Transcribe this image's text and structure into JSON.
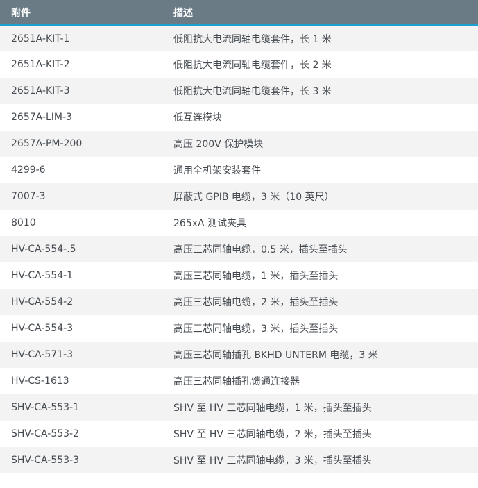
{
  "table": {
    "headers": [
      "附件",
      "描述"
    ],
    "rows": [
      [
        "2651A-KIT-1",
        "低阻抗大电流同轴电缆套件，长 1 米"
      ],
      [
        "2651A-KIT-2",
        "低阻抗大电流同轴电缆套件，长 2 米"
      ],
      [
        "2651A-KIT-3",
        "低阻抗大电流同轴电缆套件，长 3 米"
      ],
      [
        "2657A-LIM-3",
        "低互连模块"
      ],
      [
        "2657A-PM-200",
        "高压 200V 保护模块"
      ],
      [
        "4299-6",
        "通用全机架安装套件"
      ],
      [
        "7007-3",
        "屏蔽式 GPIB 电缆，3 米（10 英尺）"
      ],
      [
        "8010",
        "265xA 测试夹具"
      ],
      [
        "HV-CA-554-.5",
        "高压三芯同轴电缆，0.5 米，插头至插头"
      ],
      [
        "HV-CA-554-1",
        "高压三芯同轴电缆，1 米，插头至插头"
      ],
      [
        "HV-CA-554-2",
        "高压三芯同轴电缆，2 米，插头至插头"
      ],
      [
        "HV-CA-554-3",
        "高压三芯同轴电缆，3 米，插头至插头"
      ],
      [
        "HV-CA-571-3",
        "高压三芯同轴插孔 BKHD UNTERM 电缆，3 米"
      ],
      [
        "HV-CS-1613",
        "高压三芯同轴插孔馈通连接器"
      ],
      [
        "SHV-CA-553-1",
        "SHV 至 HV 三芯同轴电缆，1 米，插头至插头"
      ],
      [
        "SHV-CA-553-2",
        "SHV 至 HV 三芯同轴电缆，2 米，插头至插头"
      ],
      [
        "SHV-CA-553-3",
        "SHV 至 HV 三芯同轴电缆，3 米，插头至插头"
      ]
    ]
  },
  "colors": {
    "header_bg": "#6b7b86",
    "header_accent": "#1ea0d2",
    "row_alt_bg": "#f3f3f3",
    "text": "#444a50"
  }
}
